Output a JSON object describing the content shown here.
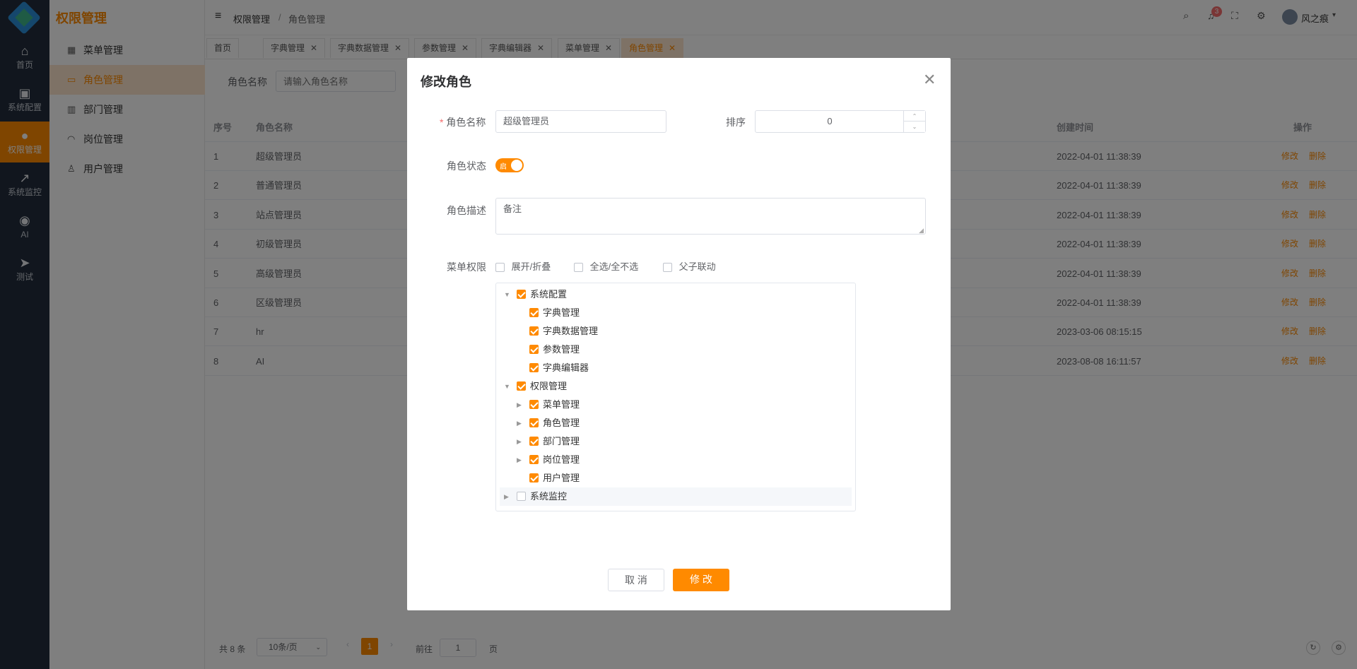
{
  "rail": {
    "items": [
      {
        "label": "首页"
      },
      {
        "label": "系统配置"
      },
      {
        "label": "权限管理"
      },
      {
        "label": "系统监控"
      },
      {
        "label": "AI"
      },
      {
        "label": "测试"
      }
    ]
  },
  "sidebar": {
    "title": "权限管理",
    "items": [
      {
        "label": "菜单管理"
      },
      {
        "label": "角色管理"
      },
      {
        "label": "部门管理"
      },
      {
        "label": "岗位管理"
      },
      {
        "label": "用户管理"
      }
    ]
  },
  "header": {
    "breadcrumb_1": "权限管理",
    "breadcrumb_sep": "/",
    "breadcrumb_2": "角色管理",
    "notification_count": "3",
    "username": "风之痕"
  },
  "tabs": [
    {
      "label": "首页"
    },
    {
      "label": "字典管理"
    },
    {
      "label": "字典数据管理"
    },
    {
      "label": "参数管理"
    },
    {
      "label": "字典编辑器"
    },
    {
      "label": "菜单管理"
    },
    {
      "label": "角色管理"
    }
  ],
  "search": {
    "label": "角色名称",
    "placeholder": "请输入角色名称"
  },
  "table": {
    "headers": {
      "index": "序号",
      "name": "角色名称",
      "created": "创建时间",
      "ops": "操作"
    },
    "rows": [
      {
        "index": "1",
        "name": "超级管理员",
        "created": "2022-04-01 11:38:39"
      },
      {
        "index": "2",
        "name": "普通管理员",
        "created": "2022-04-01 11:38:39"
      },
      {
        "index": "3",
        "name": "站点管理员",
        "created": "2022-04-01 11:38:39"
      },
      {
        "index": "4",
        "name": "初级管理员",
        "created": "2022-04-01 11:38:39"
      },
      {
        "index": "5",
        "name": "高级管理员",
        "created": "2022-04-01 11:38:39"
      },
      {
        "index": "6",
        "name": "区级管理员",
        "created": "2022-04-01 11:38:39"
      },
      {
        "index": "7",
        "name": "hr",
        "created": "2023-03-06 08:15:15"
      },
      {
        "index": "8",
        "name": "AI",
        "created": "2023-08-08 16:11:57"
      }
    ],
    "edit_label": "修改",
    "delete_label": "删除"
  },
  "pagination": {
    "total": "共 8 条",
    "page_size": "10条/页",
    "current_page": "1",
    "goto_label": "前往",
    "goto_value": "1",
    "page_suffix": "页"
  },
  "dialog": {
    "title": "修改角色",
    "name_label": "角色名称",
    "name_value": "超级管理员",
    "sort_label": "排序",
    "sort_value": "0",
    "status_label": "角色状态",
    "status_text": "启",
    "desc_label": "角色描述",
    "desc_value": "备注",
    "menu_label": "菜单权限",
    "opt_expand": "展开/折叠",
    "opt_select_all": "全选/全不选",
    "opt_linkage": "父子联动",
    "tree": [
      {
        "label": "系统配置",
        "checked": true,
        "level": 0,
        "arrow": "down"
      },
      {
        "label": "字典管理",
        "checked": true,
        "level": 1,
        "arrow": "none"
      },
      {
        "label": "字典数据管理",
        "checked": true,
        "level": 1,
        "arrow": "none"
      },
      {
        "label": "参数管理",
        "checked": true,
        "level": 1,
        "arrow": "none"
      },
      {
        "label": "字典编辑器",
        "checked": true,
        "level": 1,
        "arrow": "none"
      },
      {
        "label": "权限管理",
        "checked": true,
        "level": 0,
        "arrow": "down"
      },
      {
        "label": "菜单管理",
        "checked": true,
        "level": 1,
        "arrow": "right"
      },
      {
        "label": "角色管理",
        "checked": true,
        "level": 1,
        "arrow": "right"
      },
      {
        "label": "部门管理",
        "checked": true,
        "level": 1,
        "arrow": "right"
      },
      {
        "label": "岗位管理",
        "checked": true,
        "level": 1,
        "arrow": "right"
      },
      {
        "label": "用户管理",
        "checked": true,
        "level": 1,
        "arrow": "none"
      },
      {
        "label": "系统监控",
        "checked": false,
        "level": 0,
        "arrow": "right"
      }
    ],
    "cancel_label": "取 消",
    "submit_label": "修 改"
  },
  "colors": {
    "accent": "#ff8a00",
    "rail_bg": "#222d3c",
    "active_bg": "#fde5cc"
  }
}
